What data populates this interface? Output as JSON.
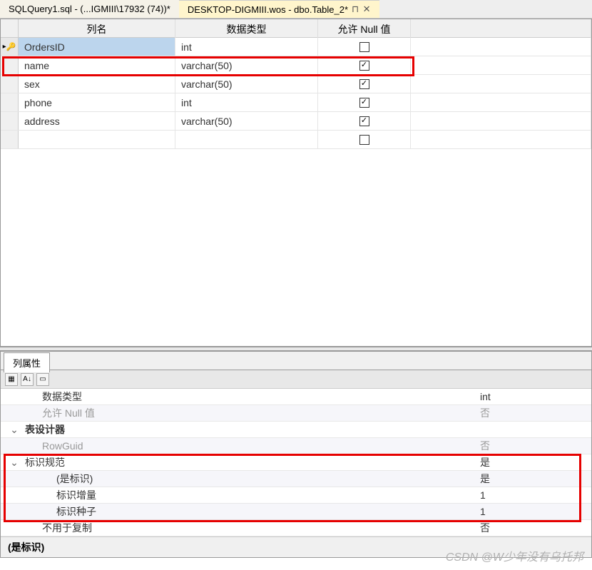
{
  "tabs": {
    "inactive": "SQLQuery1.sql - (...IGMIII\\17932 (74))*",
    "active": "DESKTOP-DIGMIII.wos - dbo.Table_2*"
  },
  "headers": {
    "colName": "列名",
    "dataType": "数据类型",
    "allowNull": "允许 Null 值"
  },
  "columns": [
    {
      "name": "OrdersID",
      "type": "int",
      "null": false,
      "pk": true,
      "selected": true
    },
    {
      "name": "name",
      "type": "varchar(50)",
      "null": true,
      "pk": false,
      "selected": false
    },
    {
      "name": "sex",
      "type": "varchar(50)",
      "null": true,
      "pk": false,
      "selected": false
    },
    {
      "name": "phone",
      "type": "int",
      "null": true,
      "pk": false,
      "selected": false
    },
    {
      "name": "address",
      "type": "varchar(50)",
      "null": true,
      "pk": false,
      "selected": false
    }
  ],
  "propsTab": "列属性",
  "props": {
    "dataType": {
      "label": "数据类型",
      "value": "int"
    },
    "allowNull": {
      "label": "允许 Null 值",
      "value": "否"
    },
    "designer": {
      "label": "表设计器",
      "value": ""
    },
    "rowGuid": {
      "label": "RowGuid",
      "value": "否"
    },
    "identitySpec": {
      "label": "标识规范",
      "value": "是"
    },
    "isIdentity": {
      "label": "(是标识)",
      "value": "是"
    },
    "increment": {
      "label": "标识增量",
      "value": "1"
    },
    "seed": {
      "label": "标识种子",
      "value": "1"
    },
    "notForRepl": {
      "label": "不用于复制",
      "value": "否"
    }
  },
  "descLabel": "(是标识)",
  "watermark": "CSDN @W少年没有乌托邦"
}
